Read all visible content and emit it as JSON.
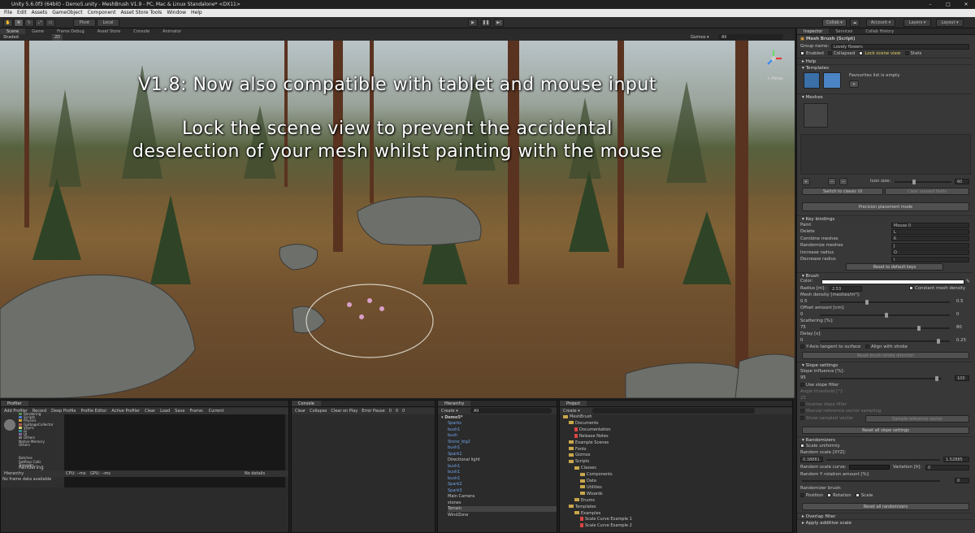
{
  "window": {
    "title": "Unity 5.6.0f3 (64bit) - Demo5.unity - MeshBrush V1.9 - PC, Mac & Linux Standalone* <DX11>",
    "controls": [
      "–",
      "□",
      "✕"
    ]
  },
  "menu": [
    "File",
    "Edit",
    "Assets",
    "GameObject",
    "Component",
    "Asset Store Tools",
    "Window",
    "Help"
  ],
  "toolbar": {
    "pivot": "Pivot",
    "local": "Local",
    "collab": "Collab ▾",
    "account": "Account ▾",
    "layers": "Layers ▾",
    "layout": "Layout ▾"
  },
  "scene_tabs": [
    "Scene",
    "Game",
    "Frame Debug",
    "Asset Store",
    "Console",
    "Animator"
  ],
  "scene_bar": {
    "shading": "Shaded",
    "mode": "2D",
    "gizmos": "Gizmos ▾",
    "search_placeholder": "All"
  },
  "scene": {
    "caption1": "V1.8: Now also compatible with tablet and mouse input",
    "caption2": "Lock the scene view to prevent the accidental",
    "caption3": "deselection of your mesh whilst painting with the mouse",
    "gizmo_label": "< Persp"
  },
  "inspector": {
    "tabs": [
      "Inspector",
      "Services",
      "Collab History"
    ],
    "component_title": "Mesh Brush (Script)",
    "group_name_label": "Group name:",
    "group_name_value": "Lovely flowers",
    "toggles": [
      "Enabled",
      "Collapsed",
      "Lock scene view",
      "Stats"
    ],
    "help": "Help",
    "templates": "Templates",
    "favourites_empty": "Favourites list is empty",
    "meshes": "Meshes",
    "icon_size_label": "Icon size:",
    "icon_size_value": "60",
    "switch_classic": "Switch to classic UI",
    "clear_unused": "Clear unused fields",
    "precision_mode": "Precision placement mode",
    "key_bindings": "Key bindings",
    "keys": [
      {
        "label": "Paint",
        "value": "Mouse 0"
      },
      {
        "label": "Delete",
        "value": "L"
      },
      {
        "label": "Combine meshes",
        "value": "K"
      },
      {
        "label": "Randomize meshes",
        "value": "J"
      },
      {
        "label": "Increase radius",
        "value": "O"
      },
      {
        "label": "Decrease radius",
        "value": "I"
      }
    ],
    "reset_keys": "Reset to default keys",
    "brush": "Brush",
    "color_label": "Color:",
    "radius_label": "Radius [m]:",
    "radius_value": "2.53",
    "constant_density": "Constant mesh density",
    "mesh_density_label": "Mesh density [meshes/m²]:",
    "mesh_density_min": "0.5",
    "mesh_density_max": "0.5",
    "offset_label": "Offset amount [cm]:",
    "offset_min": "0",
    "offset_max": "0",
    "scattering_label": "Scattering [%]:",
    "scattering_min": "75",
    "scattering_max": "80",
    "delay_label": "Delay [s]:",
    "delay_min": "0",
    "delay_max": "0.25",
    "yaxis_tangent": "Y-Axis tangent to surface",
    "align_stroke": "Align with stroke",
    "reset_brush": "Reset brush stroke direction",
    "slope_settings": "Slope settings",
    "slope_influence_label": "Slope influence [%]:",
    "slope_influence_min": "95",
    "slope_influence_max": "100",
    "use_slope_filter": "Use slope filter",
    "angle_threshold": "Angle threshold [°]:",
    "angle_threshold_value": "25",
    "inverse_slope": "Inverse slope filter",
    "manual_ref": "Manual reference vector sampling",
    "show_sampled": "Show sampled vector",
    "sample_ref": "Sample reference vector",
    "reset_slope": "Reset all slope settings",
    "randomizers": "Randomizers",
    "scale_uniformly": "Scale uniformly",
    "random_scale_label": "Random scale [XYZ]:",
    "random_scale_min": "0.38881",
    "random_scale_max": "1.52885",
    "random_scale_curve": "Random scale curve:",
    "variation_label": "Variation [it]:",
    "variation_value": "0",
    "random_y_rot": "Random Y rotation amount [%]:",
    "random_y_rot_value": "0",
    "randomizer_brush": "Randomizer brush:",
    "rb_position": "Position",
    "rb_rotation": "Rotation",
    "rb_scale": "Scale",
    "reset_randomizers": "Reset all randomizers",
    "overlap_filter": "Overlap filter",
    "apply_additive": "Apply additive scale"
  },
  "profiler": {
    "tab": "Profiler",
    "toolbar": [
      "Add Profiler",
      "Record",
      "Deep Profile",
      "Profile Editor",
      "Active Profiler",
      "Clear",
      "Load",
      "Save",
      "Frame:",
      "Current"
    ],
    "cpu_items": [
      "Rendering",
      "Scripts",
      "Physics",
      "GarbageCollector",
      "VSync",
      "Gi",
      "UI",
      "Others"
    ],
    "cpu_more": [
      "Native Memory",
      "Others"
    ],
    "rendering_label": "Rendering",
    "rendering_items": [
      "Batches",
      "SetPass Calls",
      "Triangles"
    ],
    "hierarchy_bar": [
      "Hierarchy",
      "CPU: --ms",
      "GPU: --ms"
    ],
    "no_details": "No details",
    "no_frame": "No frame data available"
  },
  "console": {
    "tab": "Console",
    "toolbar": [
      "Clear",
      "Collapse",
      "Clear on Play",
      "Error Pause"
    ],
    "counts": [
      "0",
      "0",
      "0"
    ]
  },
  "hierarchy": {
    "tab": "Hierarchy",
    "create": "Create ▾",
    "search_placeholder": "All",
    "scene": "Demo5*",
    "items": [
      "Sparks",
      "bush1",
      "bush",
      "Stone_big2",
      "bush1",
      "Spark1",
      "Directional light",
      "bush1",
      "bush1",
      "bush1",
      "Spark2",
      "Spark3",
      "Main Camera",
      "stones",
      "Terrain",
      "WindZone"
    ]
  },
  "project": {
    "tab": "Project",
    "create": "Create ▾",
    "tree": [
      {
        "d": 0,
        "t": "folder",
        "n": "MeshBrush"
      },
      {
        "d": 1,
        "t": "folder",
        "n": "Documents"
      },
      {
        "d": 2,
        "t": "doc",
        "n": "Documentation"
      },
      {
        "d": 2,
        "t": "doc",
        "n": "Release Notes"
      },
      {
        "d": 1,
        "t": "folder",
        "n": "Example Scenes"
      },
      {
        "d": 1,
        "t": "folder",
        "n": "Fonts"
      },
      {
        "d": 1,
        "t": "folder",
        "n": "Gizmos"
      },
      {
        "d": 1,
        "t": "folder",
        "n": "Scripts"
      },
      {
        "d": 2,
        "t": "folder",
        "n": "Classes"
      },
      {
        "d": 3,
        "t": "folder",
        "n": "Components"
      },
      {
        "d": 3,
        "t": "folder",
        "n": "Data"
      },
      {
        "d": 3,
        "t": "folder",
        "n": "Utilities"
      },
      {
        "d": 3,
        "t": "folder",
        "n": "Wizards"
      },
      {
        "d": 2,
        "t": "folder",
        "n": "Enums"
      },
      {
        "d": 1,
        "t": "folder",
        "n": "Templates"
      },
      {
        "d": 2,
        "t": "folder",
        "n": "Examples"
      },
      {
        "d": 3,
        "t": "doc",
        "n": "Scale Curve Example 1"
      },
      {
        "d": 3,
        "t": "doc",
        "n": "Scale Curve Example 2"
      }
    ]
  },
  "colors": {
    "accent": "#3a72b0",
    "blue_text": "#6fa3e6",
    "panel": "#383838"
  }
}
